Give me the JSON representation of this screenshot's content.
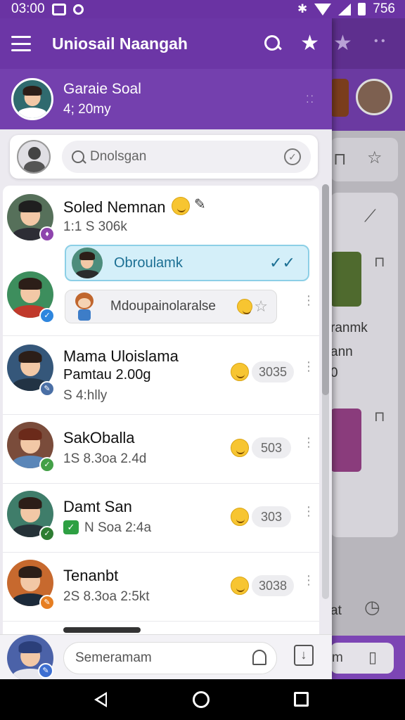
{
  "status_bar": {
    "time": "03:00",
    "battery": "756"
  },
  "app_bar": {
    "title": "Uniosail Naangah"
  },
  "profile": {
    "name": "Garaie Soal",
    "subtitle": "4; 20my"
  },
  "search": {
    "placeholder": "Dnolsgan"
  },
  "chats": [
    {
      "name": "Soled Nemnan",
      "subtitle": "1:1 S 306k",
      "badge_color": "#8e44ad"
    },
    {
      "name": "",
      "subtitle": "",
      "badge_color": "#2e86de"
    },
    {
      "name": "Mama Uloislama",
      "name2": "Pamtau 2.00g",
      "subtitle": "S 4:hlly",
      "count": "3035",
      "badge_color": "#4a6fa5"
    },
    {
      "name": "SakOballa",
      "subtitle": "1S 8.3oa 2.4d",
      "count": "503",
      "badge_color": "#43a047"
    },
    {
      "name": "Damt San",
      "subtitle": "N Soa 2:4a",
      "count": "303",
      "badge_color": "#2e7d32"
    },
    {
      "name": "Tenanbt",
      "subtitle": "2S 8.3oa 2:5kt",
      "count": "3038",
      "badge_color": "#e67e22"
    }
  ],
  "bubbles": {
    "blue_text": "Obroulamk",
    "gray_text": "Mdoupainolaralse"
  },
  "compose": {
    "placeholder": "Semeramam"
  },
  "background": {
    "text1": "ranmk",
    "text2": "ann",
    "text3": "0",
    "text4": "at",
    "bottom_text": "m"
  }
}
